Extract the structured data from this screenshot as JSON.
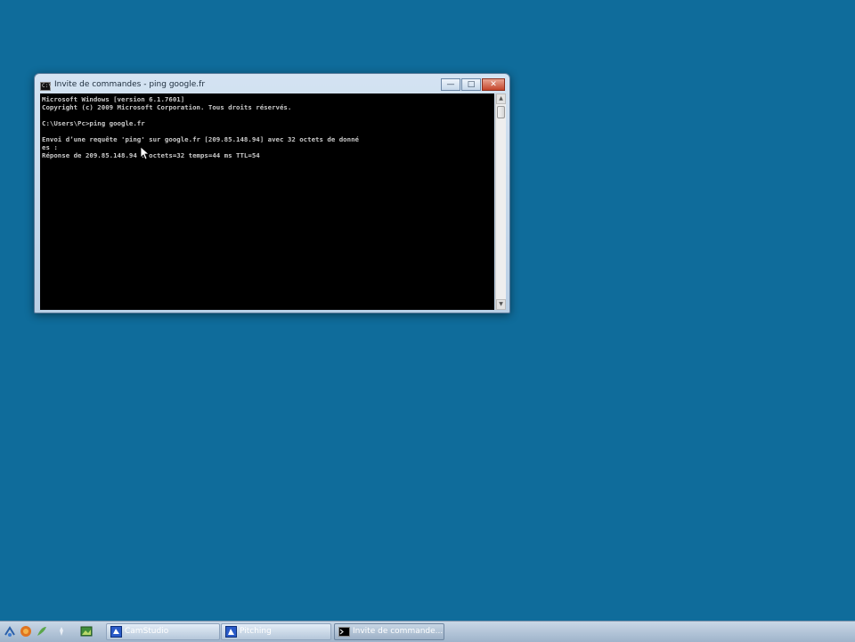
{
  "window": {
    "title": "Invite de commandes - ping google.fr",
    "app_icon_glyph": "C:\\",
    "caption": {
      "minimize_glyph": "—",
      "maximize_glyph": "□",
      "close_glyph": "✕"
    },
    "console_lines": [
      "Microsoft Windows [version 6.1.7601]",
      "Copyright (c) 2009 Microsoft Corporation. Tous droits réservés.",
      "",
      "C:\\Users\\Pc>ping google.fr",
      "",
      "Envoi d’une requête 'ping' sur google.fr [209.85.148.94] avec 32 octets de donné",
      "es :",
      "Réponse de 209.85.148.94 : octets=32 temps=44 ms TTL=54"
    ],
    "scroll_up_glyph": "▲",
    "scroll_down_glyph": "▼"
  },
  "taskbar": {
    "tray_icons": [
      "network-icon",
      "fox-icon",
      "feather-icon",
      "pin-icon",
      "image-icon"
    ],
    "buttons": [
      {
        "label": "CamStudio",
        "icon": "camstudio-icon",
        "active": false
      },
      {
        "label": "Pitching",
        "icon": "app-icon",
        "active": false
      },
      {
        "label": "Invite de commande...",
        "icon": "cmd-icon",
        "active": true
      }
    ]
  },
  "colors": {
    "desktop": "#0f6c9b",
    "console_bg": "#000000",
    "console_text": "#c9c9c9"
  }
}
